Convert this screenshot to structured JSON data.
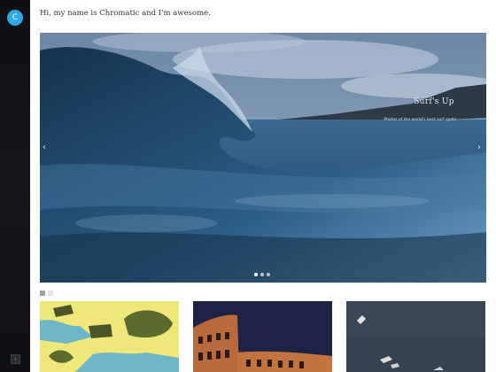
{
  "site": {
    "avatar_letter": "C",
    "greeting": "Hi, my name is Chromatic and I'm awesome."
  },
  "slider": {
    "title": "Surf's Up",
    "subtitle": "Photos of the world's best surf spots.",
    "prev_icon": "‹",
    "next_icon": "›",
    "slide_count": 3,
    "active_slide": 1
  },
  "sidebar": {
    "toggle_icon": "›"
  },
  "gallery": {
    "items": [
      {
        "name": "illustration"
      },
      {
        "name": "colosseum"
      },
      {
        "name": "seabirds"
      }
    ]
  }
}
